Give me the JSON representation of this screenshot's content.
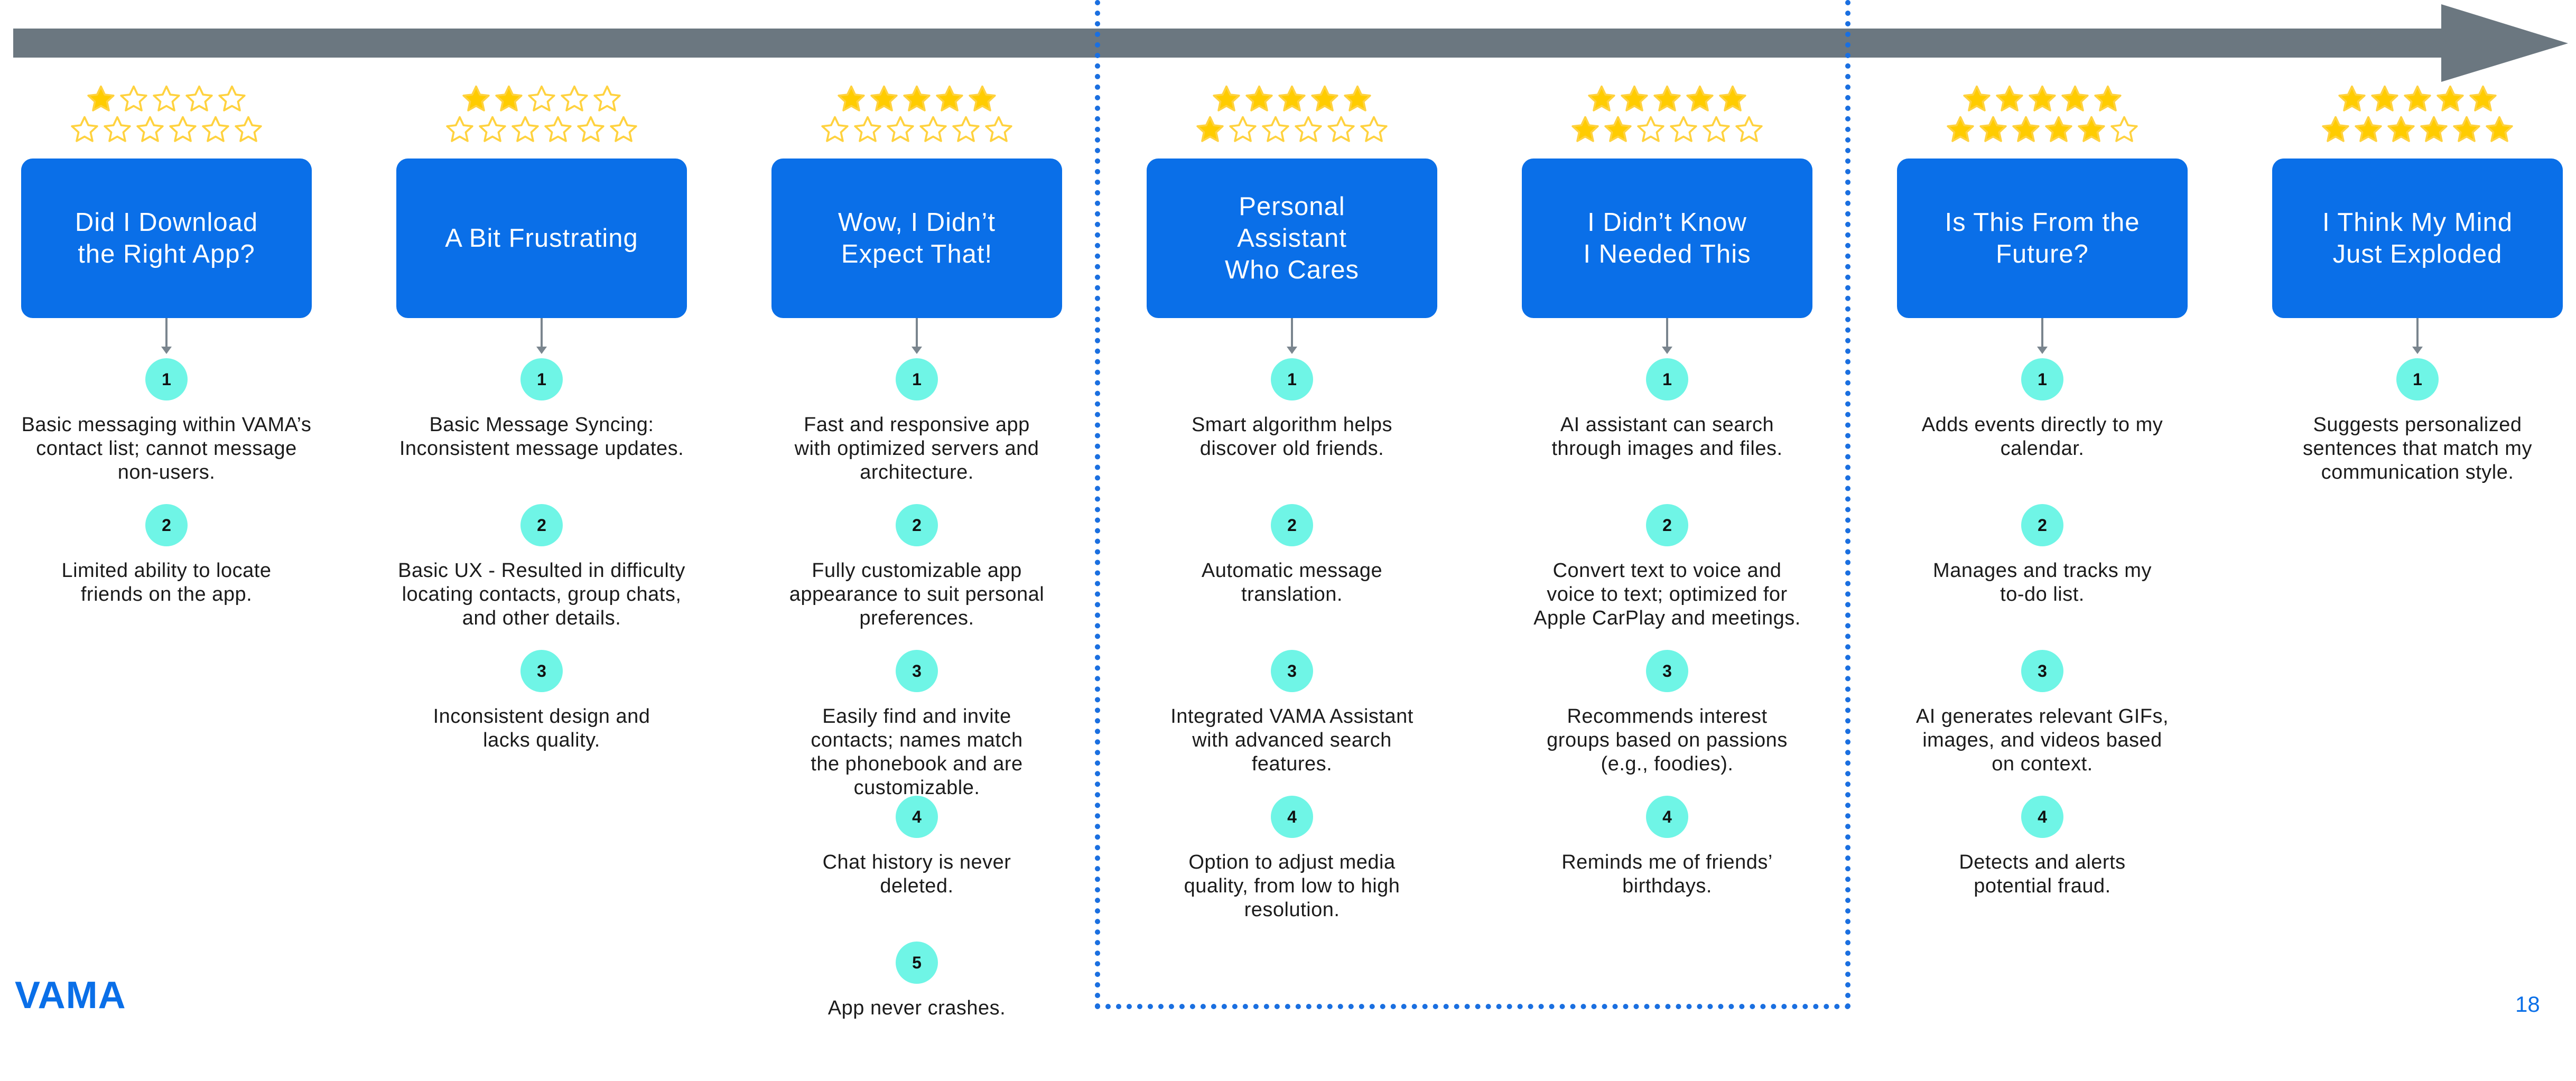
{
  "colors": {
    "arrow": "#6b7780",
    "box": "#0a6fe8",
    "badge": "#6ff5e6",
    "star_filled": "#ffcc00",
    "star_outline": "#ffd23f",
    "dotted_border": "#1a6fe0"
  },
  "stages": [
    {
      "title": "Did I Download\nthe Right App?",
      "rating": 1,
      "items": [
        {
          "num": "1",
          "text": "Basic messaging within VAMA’s\ncontact list; cannot message\nnon-users."
        },
        {
          "num": "2",
          "text": "Limited ability to locate\nfriends on the app."
        }
      ]
    },
    {
      "title": "A Bit Frustrating",
      "rating": 2,
      "items": [
        {
          "num": "1",
          "text": "Basic Message Syncing:\nInconsistent message updates."
        },
        {
          "num": "2",
          "text": "Basic UX - Resulted in difficulty\nlocating contacts, group chats,\nand other details."
        },
        {
          "num": "3",
          "text": "Inconsistent design and\nlacks quality."
        }
      ]
    },
    {
      "title": "Wow, I Didn’t\nExpect That!",
      "rating": 5,
      "items": [
        {
          "num": "1",
          "text": "Fast and responsive app\nwith optimized servers and\narchitecture."
        },
        {
          "num": "2",
          "text": "Fully customizable app\nappearance to suit personal\npreferences."
        },
        {
          "num": "3",
          "text": "Easily find and invite\ncontacts; names match\nthe phonebook and are\ncustomizable."
        },
        {
          "num": "4",
          "text": "Chat history is never\ndeleted."
        },
        {
          "num": "5",
          "text": "App never crashes."
        }
      ]
    },
    {
      "title": "Personal\nAssistant\nWho Cares",
      "rating": 6,
      "items": [
        {
          "num": "1",
          "text": "Smart algorithm helps\ndiscover old friends."
        },
        {
          "num": "2",
          "text": "Automatic message\ntranslation."
        },
        {
          "num": "3",
          "text": "Integrated VAMA Assistant\nwith advanced search\nfeatures."
        },
        {
          "num": "4",
          "text": "Option to adjust media\nquality, from low to high\nresolution."
        }
      ]
    },
    {
      "title": "I Didn’t Know\nI Needed This",
      "rating": 7,
      "items": [
        {
          "num": "1",
          "text": "AI assistant can search\nthrough images and files."
        },
        {
          "num": "2",
          "text": "Convert text to voice and\nvoice to text; optimized for\nApple CarPlay and meetings."
        },
        {
          "num": "3",
          "text": "Recommends interest\ngroups based on passions\n(e.g., foodies)."
        },
        {
          "num": "4",
          "text": "Reminds me of friends’\nbirthdays."
        }
      ]
    },
    {
      "title": "Is This From the\nFuture?",
      "rating": 10,
      "items": [
        {
          "num": "1",
          "text": "Adds events directly to my\ncalendar."
        },
        {
          "num": "2",
          "text": "Manages and tracks my\nto-do list."
        },
        {
          "num": "3",
          "text": "AI generates relevant GIFs,\nimages, and videos based\non context."
        },
        {
          "num": "4",
          "text": "Detects and alerts\npotential fraud."
        }
      ]
    },
    {
      "title": "I Think My Mind\nJust Exploded",
      "rating": 11,
      "items": [
        {
          "num": "1",
          "text": "Suggests personalized\nsentences that match my\ncommunication style."
        }
      ]
    }
  ],
  "logo": "VAMA",
  "page_number": "18"
}
